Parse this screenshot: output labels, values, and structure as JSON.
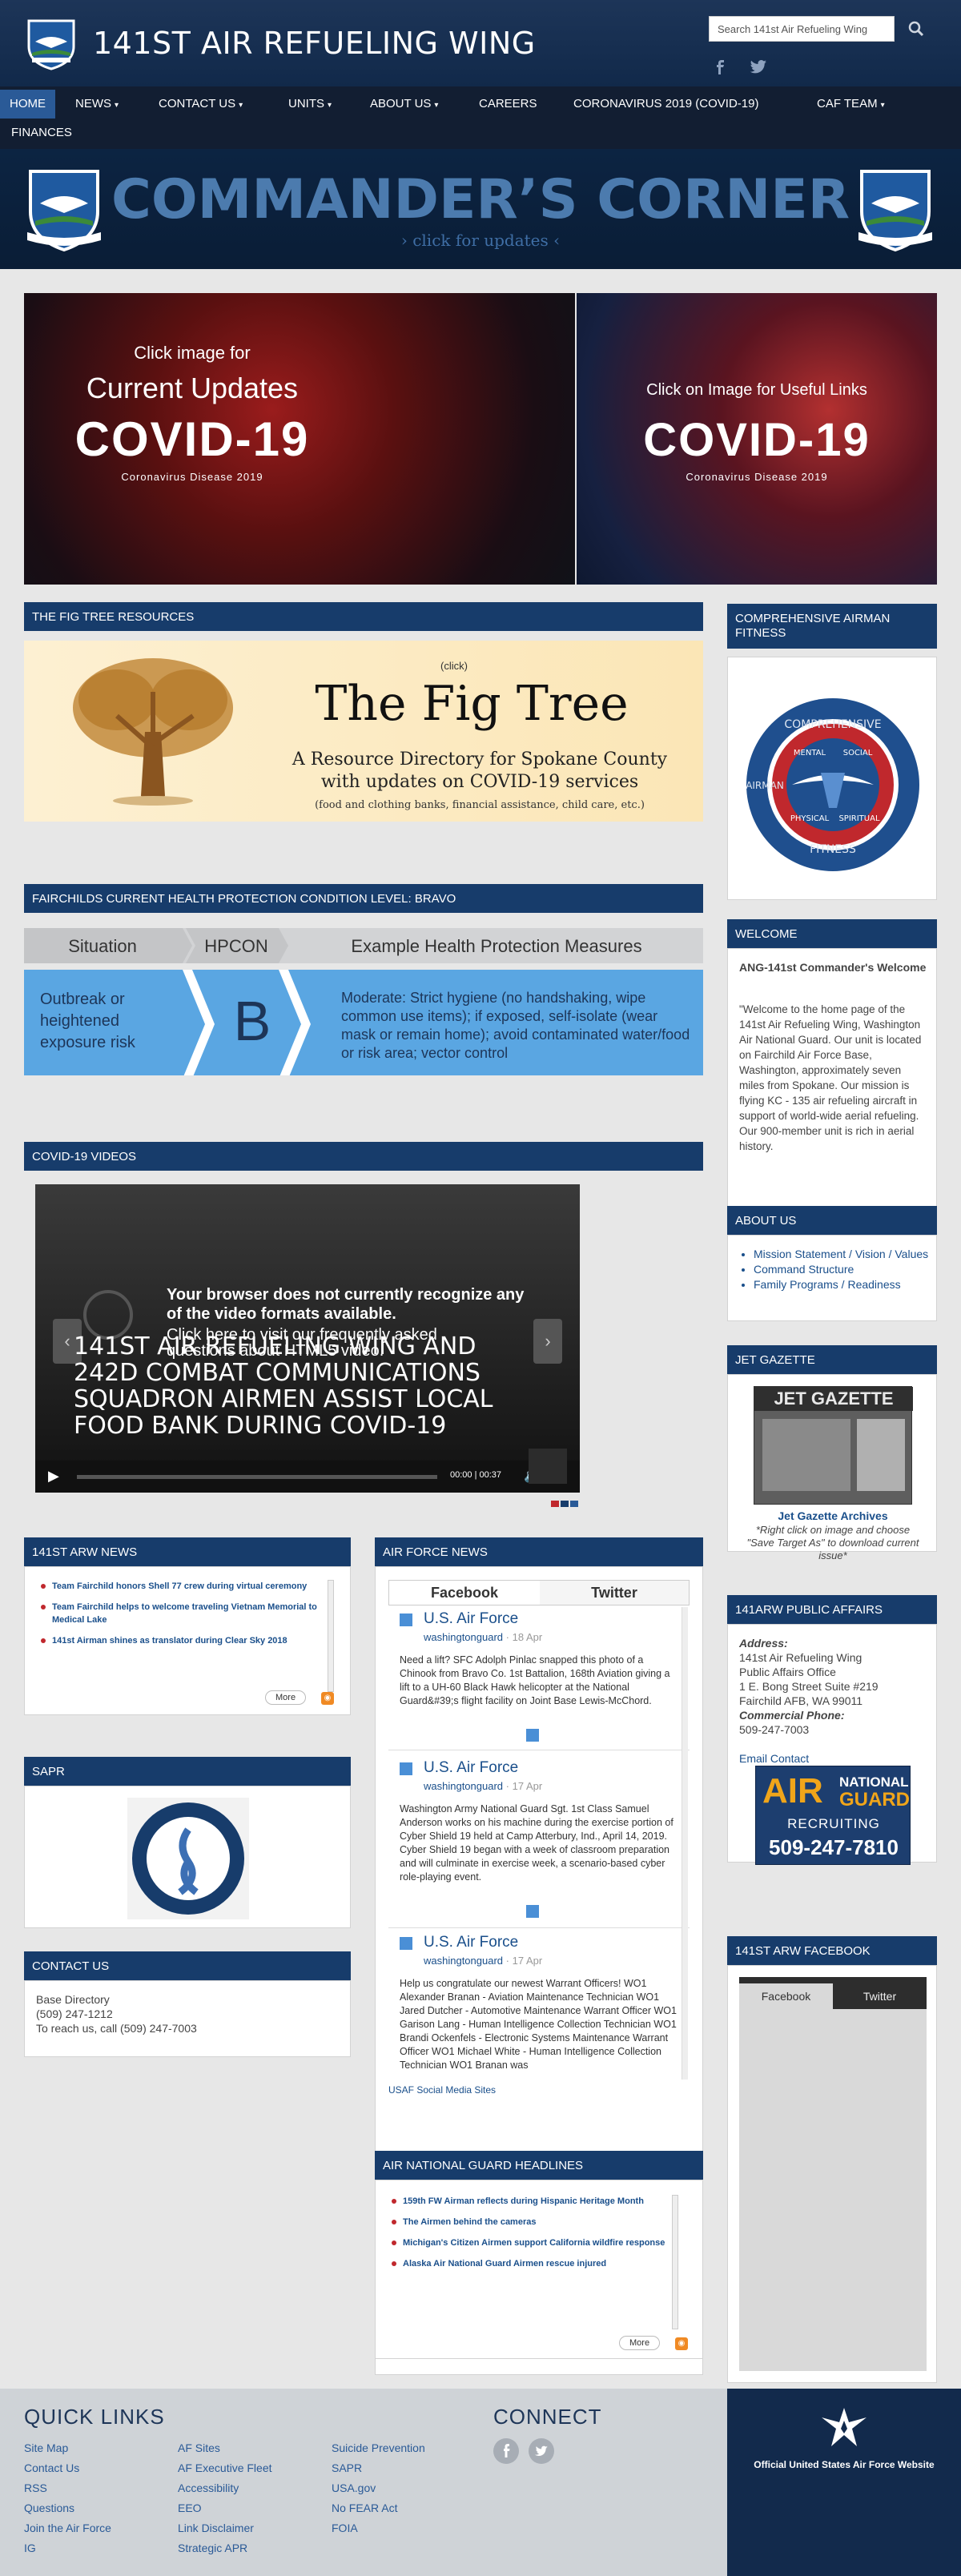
{
  "header": {
    "site_title": "141ST AIR REFUELING WING",
    "search_placeholder": "Search 141st Air Refueling Wing",
    "social_icons": [
      "facebook-icon",
      "twitter-icon"
    ]
  },
  "nav": {
    "items": [
      {
        "label": "HOME",
        "active": true,
        "caret": false
      },
      {
        "label": "NEWS",
        "caret": true
      },
      {
        "label": "CONTACT US",
        "caret": true
      },
      {
        "label": "UNITS",
        "caret": true
      },
      {
        "label": "ABOUT US",
        "caret": true
      },
      {
        "label": "CAREERS",
        "caret": false
      },
      {
        "label": "CORONAVIRUS 2019 (COVID-19)",
        "caret": false
      },
      {
        "label": "CAF TEAM",
        "caret": true
      },
      {
        "label": "FINANCES",
        "caret": false
      }
    ]
  },
  "commander": {
    "title": "COMMANDER’S CORNER",
    "subtitle": "› click for updates ‹"
  },
  "covid_banner": {
    "left_line1": "Click image for",
    "left_line2": "Current Updates",
    "left_big": "COVID-19",
    "left_small": "Coronavirus Disease 2019",
    "right_line1": "Click on Image for Useful Links",
    "right_big": "COVID-19",
    "right_small": "Coronavirus Disease 2019"
  },
  "fig_tree": {
    "header": "THE FIG TREE RESOURCES",
    "click": "(click)",
    "title": "The Fig Tree",
    "line1": "A Resource Directory for Spokane County",
    "line2": "with updates on COVID-19 services",
    "line3": "(food and clothing banks, financial assistance, child care, etc.)"
  },
  "hpcon": {
    "header": "FAIRCHILDS CURRENT HEALTH PROTECTION CONDITION LEVEL: BRAVO",
    "col1": "Situation",
    "col2": "HPCON",
    "col3": "Example Health Protection Measures",
    "situation": "Outbreak or heightened exposure risk",
    "level": "B",
    "measures": "Moderate: Strict hygiene (no handshaking, wipe common use items); if exposed, self-isolate (wear mask or remain home); avoid contaminated water/food or risk area; vector control"
  },
  "videos": {
    "header": "COVID-19 VIDEOS",
    "unsupported": "Your browser does not currently recognize any of the video formats available.",
    "faq": "Click here to visit our frequently asked questions about HTML5 video.",
    "title": "141ST AIR REFUELING WING AND 242D COMBAT COMMUNICATIONS SQUADRON AIRMEN ASSIST LOCAL FOOD BANK DURING COVID-19",
    "time_current": "00:00",
    "time_total": "00:37"
  },
  "arw_news": {
    "header": "141ST ARW NEWS",
    "items": [
      "Team Fairchild honors Shell 77 crew during virtual ceremony",
      "Team Fairchild helps to welcome traveling Vietnam Memorial to Medical Lake",
      "141st Airman shines as translator during Clear Sky 2018"
    ],
    "more": "More"
  },
  "af_news": {
    "header": "AIR FORCE NEWS",
    "tab_facebook": "Facebook",
    "tab_twitter": "Twitter",
    "posts": [
      {
        "name": "U.S. Air Force",
        "source": "washingtonguard",
        "date": "18 Apr",
        "text": "Need a lift? SFC Adolph Pinlac snapped this photo of a Chinook from Bravo Co. 1st Battalion, 168th Aviation giving a lift to a UH-60 Black Hawk helicopter at the National Guard&#39;s flight facility on Joint Base Lewis-McChord."
      },
      {
        "name": "U.S. Air Force",
        "source": "washingtonguard",
        "date": "17 Apr",
        "text": "Washington Army National Guard Sgt. 1st Class Samuel Anderson works on his machine during the exercise portion of Cyber Shield 19 held at Camp Atterbury, Ind., April 14, 2019. Cyber Shield 19 began with a week of classroom preparation and will culminate in exercise week, a scenario-based cyber role-playing event."
      },
      {
        "name": "U.S. Air Force",
        "source": "washingtonguard",
        "date": "17 Apr",
        "text": "Help us congratulate our newest Warrant Officers! WO1 Alexander Branan - Aviation Maintenance Technician WO1 Jared Dutcher - Automotive Maintenance Warrant Officer WO1 Garison Lang - Human Intelligence Collection Technician WO1 Brandi Ockenfels - Electronic Systems Maintenance Warrant Officer WO1 Michael White - Human Intelligence Collection Technician WO1 Branan was"
      }
    ],
    "footer_link": "USAF Social Media Sites"
  },
  "sapr": {
    "header": "SAPR"
  },
  "contact": {
    "header": "CONTACT US",
    "line1": "Base Directory",
    "line2": "(509) 247-1212",
    "line3": "To reach us, call (509) 247-7003"
  },
  "ang_headlines": {
    "header": "AIR NATIONAL GUARD HEADLINES",
    "items": [
      "159th FW Airman reflects during Hispanic Heritage Month",
      "The Airmen behind the cameras",
      "Michigan's Citizen Airmen support California wildfire response",
      "Alaska Air National Guard Airmen rescue injured"
    ],
    "more": "More"
  },
  "caf": {
    "header": "COMPREHENSIVE AIRMAN FITNESS",
    "ring_top": "COMPREHENSIVE",
    "ring_bottom": "FITNESS",
    "mental": "MENTAL",
    "social": "SOCIAL",
    "physical": "PHYSICAL",
    "spiritual": "SPIRITUAL",
    "left_word": "AIRMAN"
  },
  "welcome": {
    "header": "WELCOME",
    "title": "ANG-141st Commander's Welcome",
    "text": "\"Welcome to the home page of the 141st Air Refueling Wing, Washington Air National Guard. Our unit is located on Fairchild Air Force Base, Washington, approximately seven miles from Spokane. Our mission is flying KC - 135 air refueling aircraft in support of world-wide aerial refueling. Our 900-member unit is rich in aerial history."
  },
  "about": {
    "header": "ABOUT US",
    "links": [
      "Mission Statement / Vision / Values",
      "Command Structure",
      "Family Programs / Readiness"
    ]
  },
  "jet_gazette": {
    "header": "JET GAZETTE",
    "masthead": "JET GAZETTE",
    "title": "Jet Gazette Archives",
    "caption": "*Right click on image and choose \"Save Target As\" to download current issue*"
  },
  "public_affairs": {
    "header": "141ARW PUBLIC AFFAIRS",
    "address_label": "Address:",
    "address_lines": [
      "141st Air Refueling Wing",
      "Public Affairs Office",
      "1 E. Bong Street Suite #219",
      "Fairchild AFB, WA 99011"
    ],
    "phone_label": "Commercial Phone:",
    "phone": "509-247-7003",
    "email": "Email Contact"
  },
  "recruiting": {
    "air": "AIR",
    "national": "NATIONAL",
    "guard": "GUARD",
    "recruiting": "RECRUITING",
    "phone": "509-247-7810"
  },
  "arw_facebook": {
    "header": "141ST ARW FACEBOOK",
    "tab_facebook": "Facebook",
    "tab_twitter": "Twitter"
  },
  "footer": {
    "quick_links_title": "QUICK LINKS",
    "col1": [
      "Site Map",
      "Contact Us",
      "RSS",
      "Questions",
      "Join the Air Force",
      "IG"
    ],
    "col2": [
      "AF Sites",
      "AF Executive Fleet",
      "Accessibility",
      "EEO",
      "Link Disclaimer",
      "Strategic APR"
    ],
    "col3": [
      "Suicide Prevention",
      "SAPR",
      "USA.gov",
      "No FEAR Act",
      "FOIA"
    ],
    "connect_title": "CONNECT",
    "af_site": "Official United States Air Force Website"
  },
  "colors": {
    "navy": "#173c6b",
    "nav_bg": "#121e32",
    "hpcon_blue": "#5aa6e2",
    "accent_red": "#c0282d"
  }
}
